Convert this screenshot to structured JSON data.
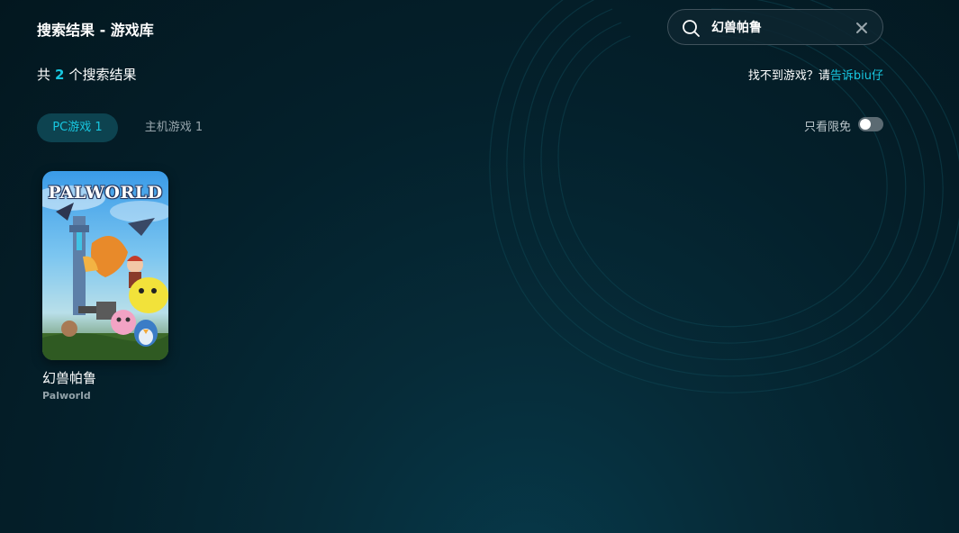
{
  "header": {
    "title": "搜索结果 - 游戏库"
  },
  "search": {
    "value": "幻兽帕鲁"
  },
  "results": {
    "prefix": "共",
    "count": "2",
    "suffix": "个搜索结果"
  },
  "feedback": {
    "text": "找不到游戏？请",
    "link": "告诉biu仔"
  },
  "tabs": [
    {
      "label": "PC游戏 1",
      "active": true
    },
    {
      "label": "主机游戏 1",
      "active": false
    }
  ],
  "filter": {
    "label": "只看限免",
    "enabled": false
  },
  "games": [
    {
      "title": "幻兽帕鲁",
      "subtitle": "Palworld",
      "cover_logo": "PALWORLD"
    }
  ],
  "colors": {
    "accent": "#18c7e0",
    "background": "#04202b",
    "active_tab_bg": "#0d4350"
  },
  "icons": [
    "search-icon",
    "close-icon"
  ]
}
